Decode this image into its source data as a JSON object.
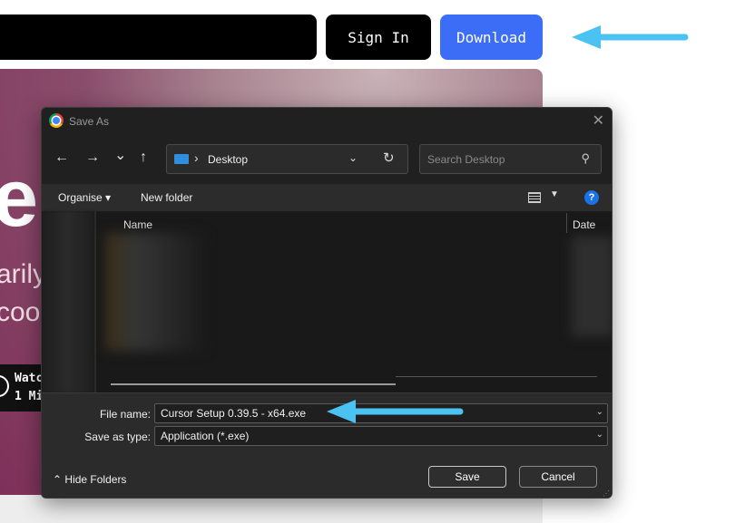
{
  "site": {
    "signin_label": "Sign In",
    "download_label": "Download",
    "hero_big": "e",
    "hero_line1": "arily",
    "hero_line2": "coo",
    "watch_line1": "Watc",
    "watch_line2": "1 Mi"
  },
  "colors": {
    "download_bg": "#3b6df6",
    "arrow": "#4bc3f2",
    "dialog_bg": "#202020"
  },
  "dialog": {
    "title": "Save As",
    "close_glyph": "✕",
    "nav": {
      "back_glyph": "←",
      "forward_glyph": "→",
      "recent_glyph": "⌄",
      "up_glyph": "↑",
      "address_separator": "›",
      "location": "Desktop",
      "address_dropdown_glyph": "⌄",
      "refresh_glyph": "↻",
      "search_placeholder": "Search Desktop",
      "search_glyph": "⚲"
    },
    "toolbar": {
      "organise_label": "Organise ▾",
      "new_folder_label": "New folder",
      "view_dropdown_glyph": "▼",
      "help_glyph": "?"
    },
    "columns": {
      "name": "Name",
      "date": "Date"
    },
    "form": {
      "filename_label": "File name:",
      "filename_value": "Cursor Setup 0.39.5 - x64.exe",
      "filetype_label": "Save as type:",
      "filetype_value": "Application (*.exe)",
      "dropdown_glyph": "⌄",
      "hide_folders_label": "Hide Folders",
      "hide_folders_glyph": "⌃",
      "save_label": "Save",
      "cancel_label": "Cancel",
      "resize_glyph": "⋰"
    }
  }
}
